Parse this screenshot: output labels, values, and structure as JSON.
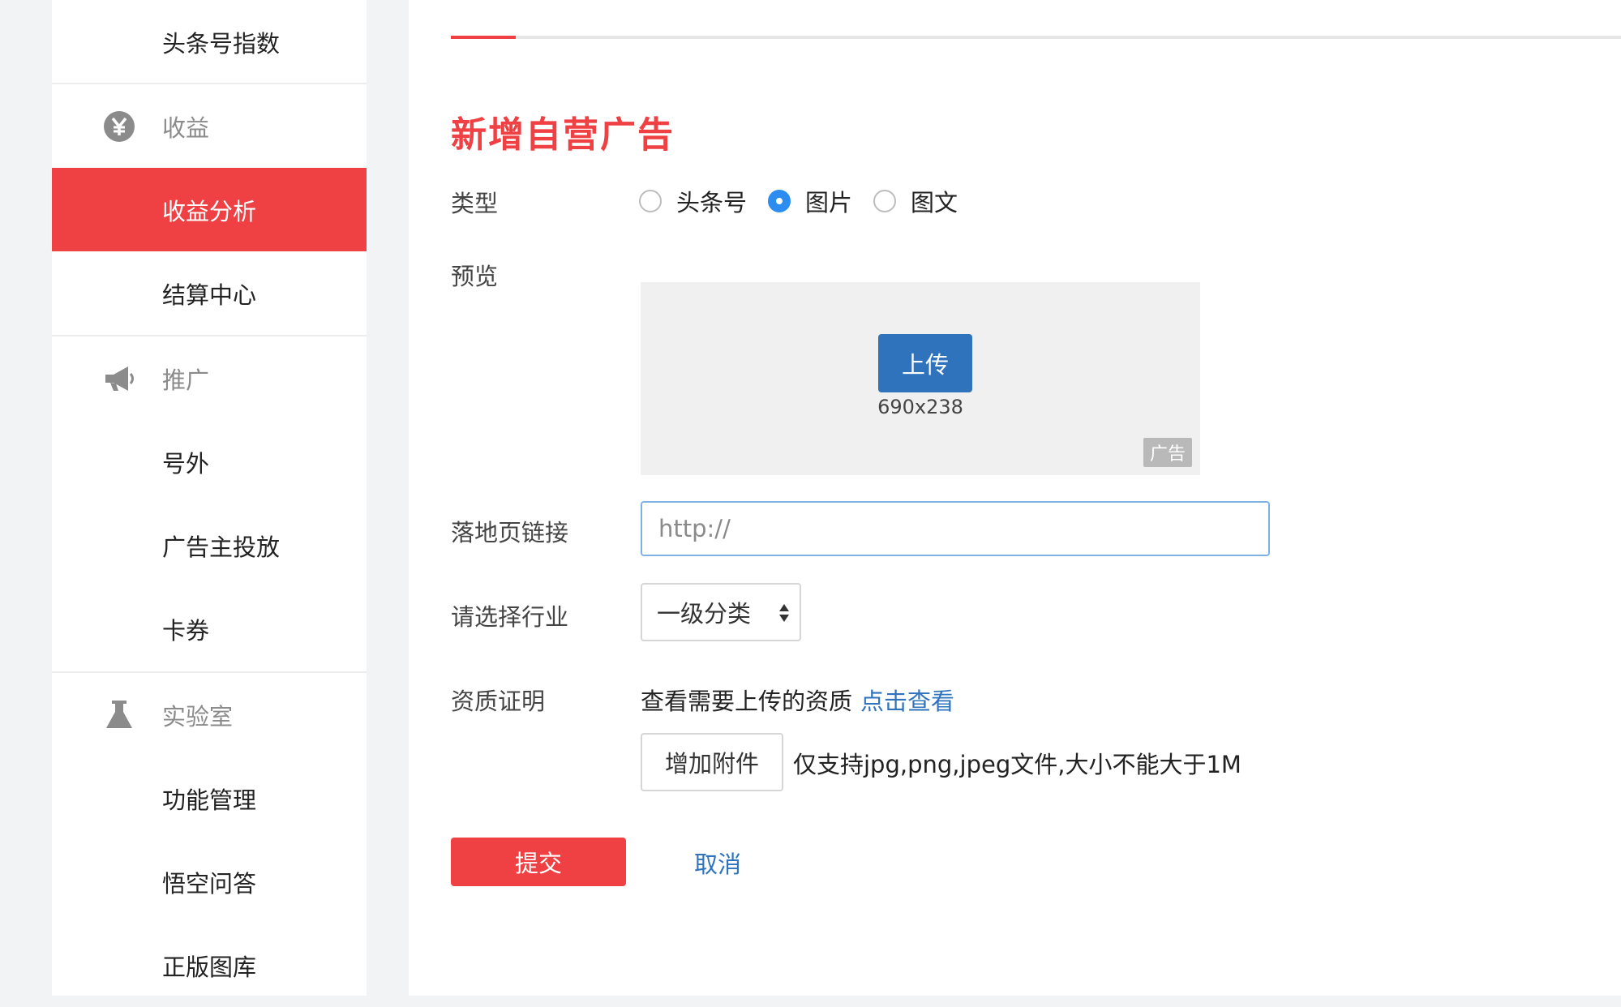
{
  "sidebar": {
    "items": [
      {
        "label": "头条号指数",
        "type": "item",
        "icon": ""
      },
      {
        "label": "收益",
        "type": "section",
        "icon": "yen-coin-icon"
      },
      {
        "label": "收益分析",
        "type": "item",
        "active": true,
        "icon": ""
      },
      {
        "label": "结算中心",
        "type": "item",
        "icon": ""
      },
      {
        "label": "推广",
        "type": "section",
        "icon": "megaphone-icon"
      },
      {
        "label": "号外",
        "type": "item",
        "icon": ""
      },
      {
        "label": "广告主投放",
        "type": "item",
        "icon": ""
      },
      {
        "label": "卡券",
        "type": "item",
        "icon": ""
      },
      {
        "label": "实验室",
        "type": "section",
        "icon": "flask-icon"
      },
      {
        "label": "功能管理",
        "type": "item",
        "icon": ""
      },
      {
        "label": "悟空问答",
        "type": "item",
        "icon": ""
      },
      {
        "label": "正版图库",
        "type": "item",
        "icon": ""
      }
    ]
  },
  "form": {
    "title": "新增自营广告",
    "type_label": "类型",
    "type_options": [
      {
        "label": "头条号",
        "checked": false
      },
      {
        "label": "图片",
        "checked": true
      },
      {
        "label": "图文",
        "checked": false
      }
    ],
    "preview_label": "预览",
    "upload_label": "上传",
    "preview_size": "690x238",
    "ad_tag": "广告",
    "landing_label": "落地页链接",
    "landing_placeholder": "http://",
    "industry_label": "请选择行业",
    "industry_selected": "一级分类",
    "qualification_label": "资质证明",
    "qualification_text": "查看需要上传的资质",
    "qualification_link": "点击查看",
    "attach_label": "增加附件",
    "attach_hint": "仅支持jpg,png,jpeg文件,大小不能大于1M",
    "submit_label": "提交",
    "cancel_label": "取消"
  },
  "colors": {
    "accent": "#ef4044",
    "link": "#2f73bd",
    "radio_checked": "#2d8cf0"
  }
}
